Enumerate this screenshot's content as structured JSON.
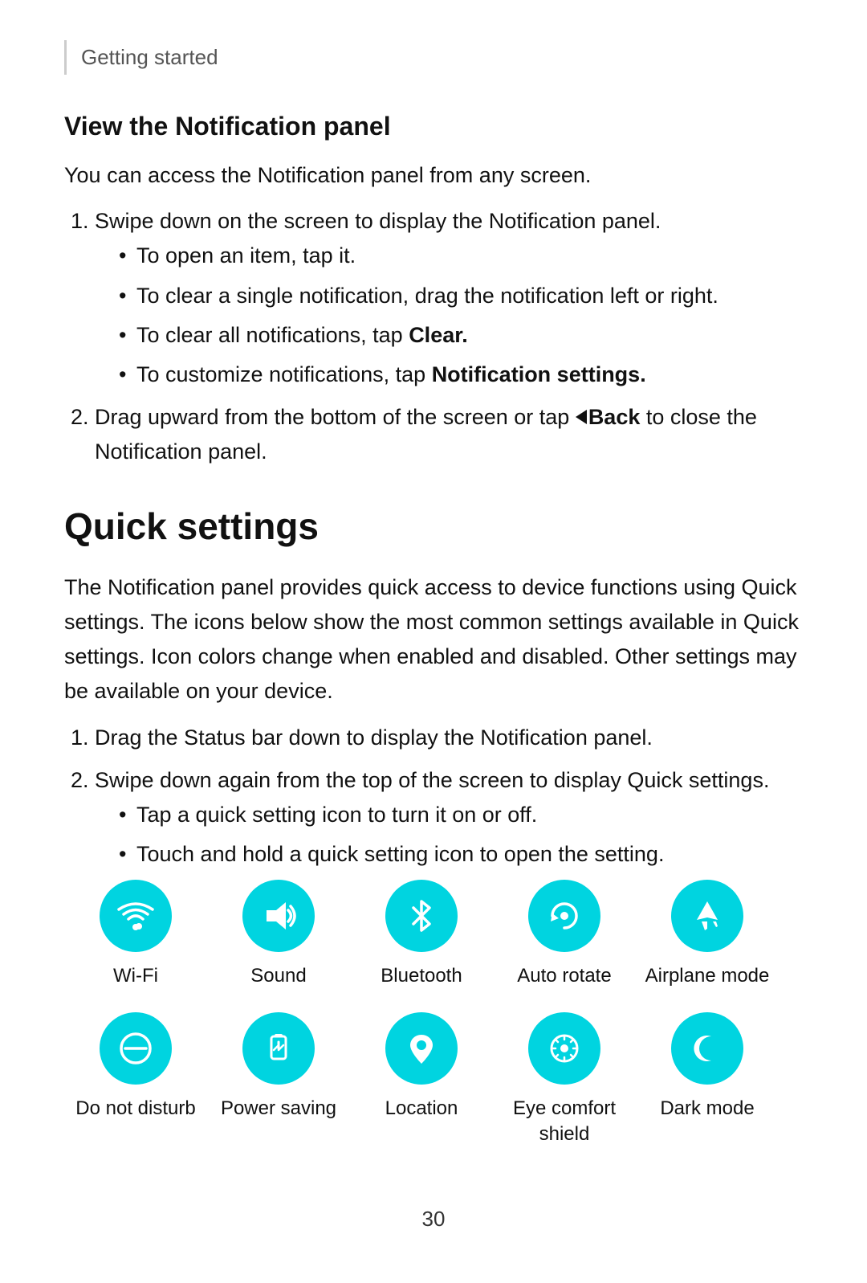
{
  "header": {
    "text": "Getting started"
  },
  "section1": {
    "title": "View the Notification panel",
    "intro": "You can access the Notification panel from any screen.",
    "steps": [
      {
        "text": "Swipe down on the screen to display the Notification panel.",
        "bullets": [
          "To open an item, tap it.",
          "To clear a single notification, drag the notification left or right.",
          "To clear all notifications, tap ",
          "To customize notifications, tap "
        ],
        "bullet_bold": [
          "Clear.",
          "Notification settings."
        ]
      },
      {
        "text_before": "Drag upward from the bottom of the screen or tap ",
        "back_label": "Back",
        "text_after": " to close the Notification panel."
      }
    ]
  },
  "section2": {
    "title": "Quick settings",
    "intro": "The Notification panel provides quick access to device functions using Quick settings. The icons below show the most common settings available in Quick settings. Icon colors change when enabled and disabled. Other settings may be available on your device.",
    "steps": [
      "Drag the Status bar down to display the Notification panel.",
      "Swipe down again from the top of the screen to display Quick settings."
    ],
    "sub_bullets": [
      "Tap a quick setting icon to turn it on or off.",
      "Touch and hold a quick setting icon to open the setting."
    ]
  },
  "icons_row1": [
    {
      "name": "wifi-icon",
      "label": "Wi-Fi",
      "symbol": "wifi"
    },
    {
      "name": "sound-icon",
      "label": "Sound",
      "symbol": "sound"
    },
    {
      "name": "bluetooth-icon",
      "label": "Bluetooth",
      "symbol": "bluetooth"
    },
    {
      "name": "autorotate-icon",
      "label": "Auto rotate",
      "symbol": "autorotate"
    },
    {
      "name": "airplane-icon",
      "label": "Airplane mode",
      "symbol": "airplane"
    }
  ],
  "icons_row2": [
    {
      "name": "donotdisturb-icon",
      "label": "Do not disturb",
      "symbol": "dnd"
    },
    {
      "name": "powersaving-icon",
      "label": "Power saving",
      "symbol": "powersave"
    },
    {
      "name": "location-icon",
      "label": "Location",
      "symbol": "location"
    },
    {
      "name": "eyecomfort-icon",
      "label": "Eye comfort\nshield",
      "symbol": "eyecomfort"
    },
    {
      "name": "darkmode-icon",
      "label": "Dark mode",
      "symbol": "darkmode"
    }
  ],
  "page_number": "30"
}
